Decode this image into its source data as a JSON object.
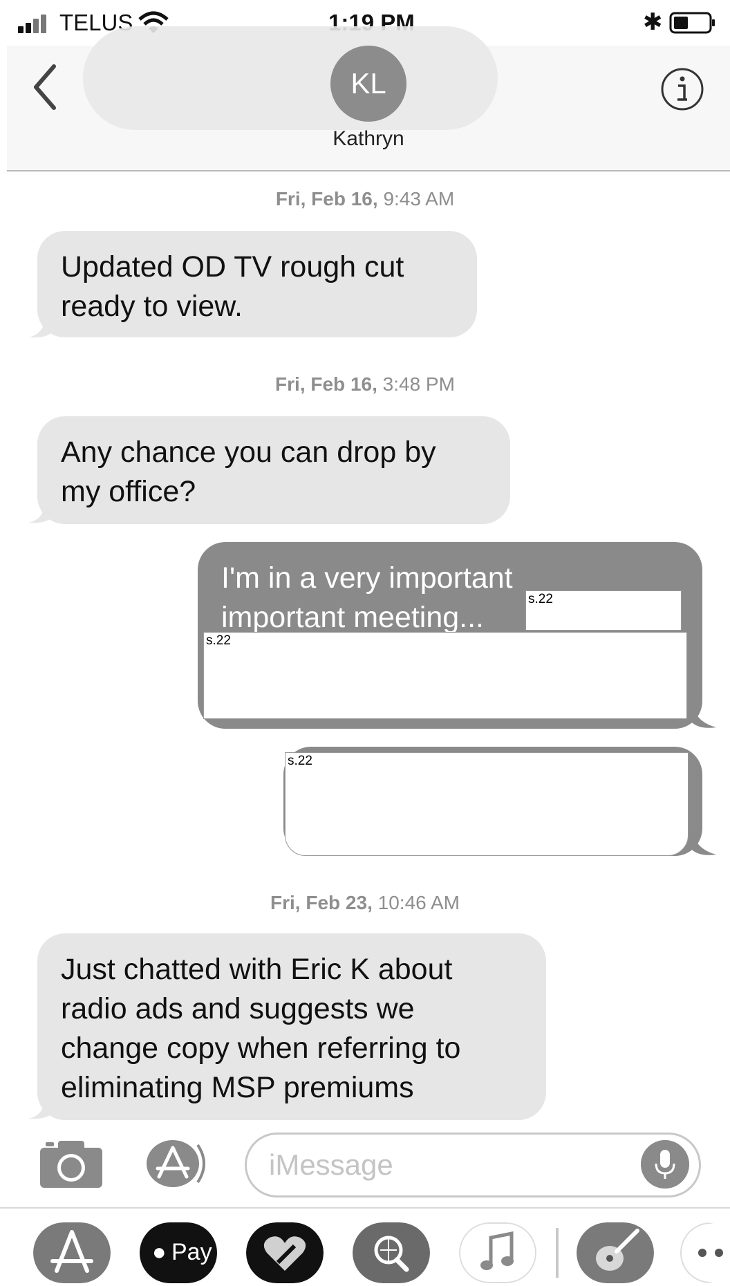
{
  "status_bar": {
    "carrier": "TELUS",
    "time": "1:19 PM"
  },
  "header": {
    "avatar_initials": "KL",
    "contact_name": "Kathryn"
  },
  "messages": [
    {
      "type": "timestamp",
      "day": "Fri, Feb 16,",
      "time": "9:43 AM"
    },
    {
      "type": "incoming",
      "lines": [
        "Updated OD TV rough cut",
        "ready to view."
      ]
    },
    {
      "type": "timestamp",
      "day": "Fri, Feb 16,",
      "time": "3:48 PM"
    },
    {
      "type": "incoming",
      "lines": [
        "Any chance you can drop by",
        "my office?"
      ]
    },
    {
      "type": "outgoing",
      "lines": [
        "I'm in a very important",
        "important meeting..."
      ]
    },
    {
      "type": "timestamp",
      "day": "Fri, Feb 23,",
      "time": "10:46 AM"
    },
    {
      "type": "incoming",
      "lines": [
        "Just chatted with Eric K about",
        "radio ads and suggests we",
        "change copy when referring to",
        "eliminating MSP premiums"
      ]
    }
  ],
  "redactions": {
    "label_1": "s.22",
    "label_2": "s.22",
    "label_3": "s.22"
  },
  "input": {
    "placeholder": "iMessage"
  },
  "app_drawer": {
    "apple_pay_label": "Pay"
  },
  "colors": {
    "incoming_bubble": "#e6e6e6",
    "outgoing_bubble": "#8a8a8a",
    "timestamp": "#8e8e8e"
  },
  "icons": [
    "signal-icon",
    "wifi-icon",
    "bluetooth-icon",
    "battery-icon",
    "back-chevron-icon",
    "info-icon",
    "camera-icon",
    "app-store-icon",
    "microphone-icon",
    "apple-pay-icon",
    "digital-touch-icon",
    "web-search-icon",
    "music-icon",
    "garageband-icon",
    "more-apps-icon"
  ]
}
